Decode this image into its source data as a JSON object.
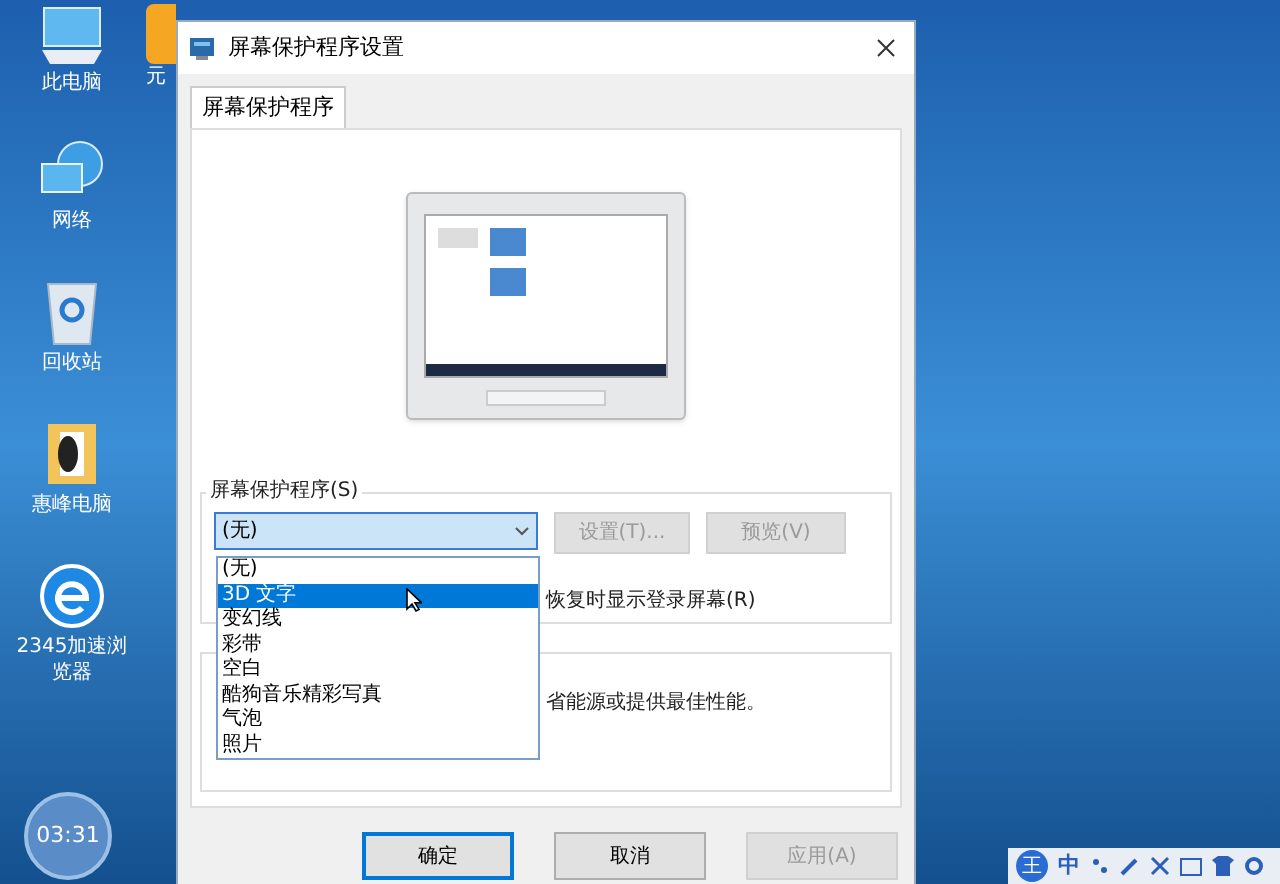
{
  "desktop_icons": [
    {
      "label": "此电脑",
      "kind": "computer"
    },
    {
      "label": "网络",
      "kind": "network"
    },
    {
      "label": "回收站",
      "kind": "recycle"
    },
    {
      "label": "惠峰电脑",
      "kind": "folder"
    },
    {
      "label": "2345加速浏览器",
      "kind": "browser"
    }
  ],
  "partial_icon": {
    "label": "元"
  },
  "clock": "03:31",
  "window": {
    "title": "屏幕保护程序设置"
  },
  "tabs": [
    {
      "label": "屏幕保护程序",
      "selected": true
    }
  ],
  "screensaver_group": {
    "label": "屏幕保护程序(S)",
    "value": "(无)",
    "settings_button": {
      "label": "设置(T)...",
      "disabled": true
    },
    "preview_button": {
      "label": "预览(V)",
      "disabled": true
    },
    "resume_text": "恢复时显示登录屏幕(R)"
  },
  "dropdown_options": [
    {
      "label": "(无)",
      "selected": false
    },
    {
      "label": "3D 文字",
      "selected": true
    },
    {
      "label": "变幻线",
      "selected": false
    },
    {
      "label": "彩带",
      "selected": false
    },
    {
      "label": "空白",
      "selected": false
    },
    {
      "label": "酷狗音乐精彩写真",
      "selected": false
    },
    {
      "label": "气泡",
      "selected": false
    },
    {
      "label": "照片",
      "selected": false
    }
  ],
  "power_group": {
    "text": "省能源或提供最佳性能。"
  },
  "buttons": [
    {
      "label": "确定",
      "disabled": false,
      "focused": true
    },
    {
      "label": "取消",
      "disabled": false,
      "focused": false
    },
    {
      "label": "应用(A)",
      "disabled": true,
      "focused": false
    }
  ],
  "ime_toolbar": {
    "label": "王",
    "mode": "中"
  }
}
